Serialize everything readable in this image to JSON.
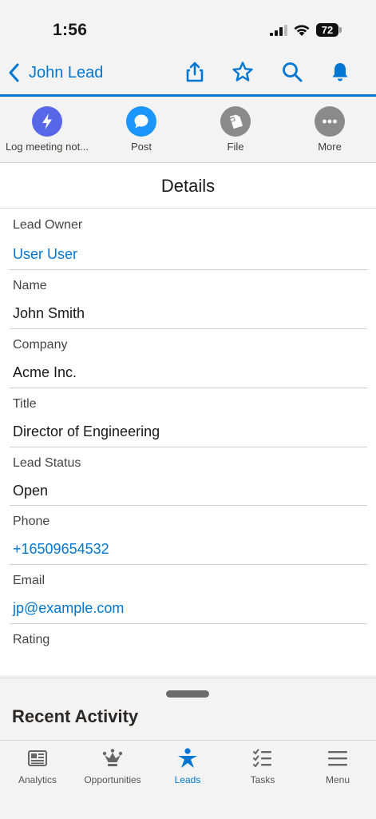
{
  "status_bar": {
    "time": "1:56",
    "battery": "72"
  },
  "nav": {
    "title": "John Lead"
  },
  "actions": [
    {
      "label": "Log meeting not...",
      "icon": "bolt-icon",
      "color": "#5867e8"
    },
    {
      "label": "Post",
      "icon": "chat-bubble-icon",
      "color": "#1b96ff"
    },
    {
      "label": "File",
      "icon": "file-icon",
      "color": "#8a8a8a"
    },
    {
      "label": "More",
      "icon": "more-icon",
      "color": "#8a8a8a"
    }
  ],
  "details": {
    "title": "Details",
    "fields": [
      {
        "label": "Lead Owner",
        "value": "User User"
      },
      {
        "label": "Name",
        "value": "John Smith"
      },
      {
        "label": "Company",
        "value": "Acme Inc."
      },
      {
        "label": "Title",
        "value": "Director of Engineering"
      },
      {
        "label": "Lead Status",
        "value": "Open"
      },
      {
        "label": "Phone",
        "value": "+16509654532"
      },
      {
        "label": "Email",
        "value": "jp@example.com"
      },
      {
        "label": "Rating",
        "value": ""
      }
    ]
  },
  "recent_activity": {
    "title": "Recent Activity"
  },
  "tabbar": {
    "tabs": [
      {
        "label": "Analytics",
        "icon": "analytics-icon"
      },
      {
        "label": "Opportunities",
        "icon": "crown-icon"
      },
      {
        "label": "Leads",
        "icon": "lead-person-icon",
        "active": true
      },
      {
        "label": "Tasks",
        "icon": "tasks-checklist-icon"
      },
      {
        "label": "Menu",
        "icon": "menu-icon"
      }
    ]
  },
  "colors": {
    "accent": "#0176d3",
    "link": "#0176d3"
  }
}
